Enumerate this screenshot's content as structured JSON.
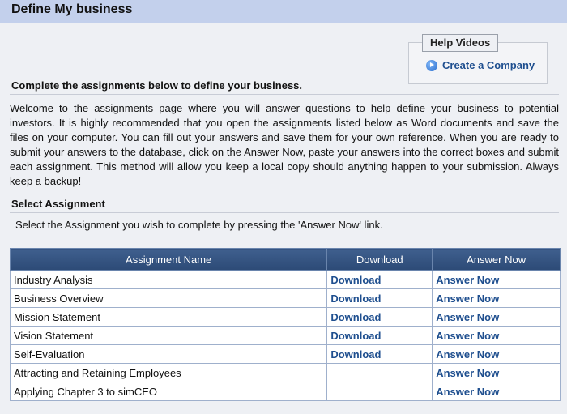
{
  "header": {
    "title": "Define My business"
  },
  "help": {
    "legend": "Help Videos",
    "link_label": "Create a Company"
  },
  "assignments_section": {
    "heading": "Complete the assignments below to define your business.",
    "intro": "Welcome to the assignments page where you will answer questions to help define your business to potential investors. It is highly recommended that you open the assignments listed below as Word documents and save the files on your computer. You can fill out your answers and save them for your own reference. When you are ready to submit your answers to the database, click on the Answer Now, paste your answers into the correct boxes and submit each assignment. This method will allow you keep a local copy should anything happen to your submission. Always keep a backup!"
  },
  "select_section": {
    "heading": "Select Assignment",
    "instruction": "Select the Assignment you wish to complete by pressing the 'Answer Now' link."
  },
  "table": {
    "headers": [
      "Assignment Name",
      "Download",
      "Answer Now"
    ],
    "rows": [
      {
        "name": "Industry Analysis",
        "download": "Download",
        "answer": "Answer Now"
      },
      {
        "name": "Business Overview",
        "download": "Download",
        "answer": "Answer Now"
      },
      {
        "name": "Mission Statement",
        "download": "Download",
        "answer": "Answer Now"
      },
      {
        "name": "Vision Statement",
        "download": "Download",
        "answer": "Answer Now"
      },
      {
        "name": "Self-Evaluation",
        "download": "Download",
        "answer": "Answer Now"
      },
      {
        "name": "Attracting and Retaining Employees",
        "download": "",
        "answer": "Answer Now"
      },
      {
        "name": "Applying Chapter 3 to simCEO",
        "download": "",
        "answer": "Answer Now"
      }
    ]
  },
  "colors": {
    "header_bg": "#c3d0ec",
    "table_header_bg": "#34527f",
    "link": "#1f4f8f"
  }
}
